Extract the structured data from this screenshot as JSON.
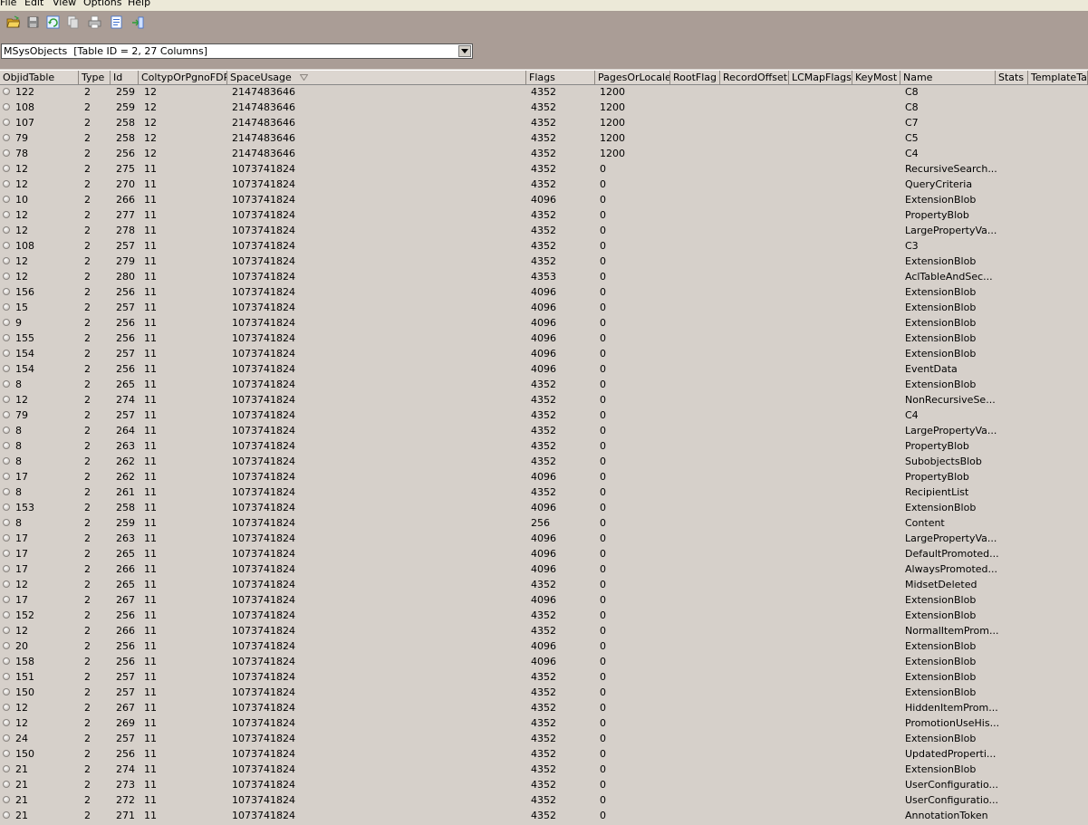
{
  "menu": [
    "File",
    "Edit",
    "View",
    "Options",
    "Help"
  ],
  "toolbar": [
    {
      "name": "open-icon",
      "color": "#d9a520"
    },
    {
      "name": "save-icon",
      "color": "#8c8c8c"
    },
    {
      "name": "refresh-icon",
      "color": "#2f9e3a"
    },
    {
      "name": "copy-icon",
      "color": "#8c8c8c"
    },
    {
      "name": "print-icon",
      "color": "#8c8c8c"
    },
    {
      "name": "export-icon",
      "color": "#3a6fd0"
    },
    {
      "name": "exit-icon",
      "color": "#3a6fd0"
    }
  ],
  "table_select": {
    "value": "MSysObjects  [Table ID = 2, 27 Columns]"
  },
  "columns": [
    "ObjidTable",
    "Type",
    "Id",
    "ColtypOrPgnoFDP",
    "SpaceUsage",
    "Flags",
    "PagesOrLocale",
    "RootFlag",
    "RecordOffset",
    "LCMapFlags",
    "KeyMost",
    "Name",
    "Stats",
    "TemplateTab"
  ],
  "rows": [
    [
      "122",
      "2",
      "259",
      "12",
      "2147483646",
      "4352",
      "1200",
      "C8"
    ],
    [
      "108",
      "2",
      "259",
      "12",
      "2147483646",
      "4352",
      "1200",
      "C8"
    ],
    [
      "107",
      "2",
      "258",
      "12",
      "2147483646",
      "4352",
      "1200",
      "C7"
    ],
    [
      "79",
      "2",
      "258",
      "12",
      "2147483646",
      "4352",
      "1200",
      "C5"
    ],
    [
      "78",
      "2",
      "256",
      "12",
      "2147483646",
      "4352",
      "1200",
      "C4"
    ],
    [
      "12",
      "2",
      "275",
      "11",
      "1073741824",
      "4352",
      "0",
      "RecursiveSearch..."
    ],
    [
      "12",
      "2",
      "270",
      "11",
      "1073741824",
      "4352",
      "0",
      "QueryCriteria"
    ],
    [
      "10",
      "2",
      "266",
      "11",
      "1073741824",
      "4096",
      "0",
      "ExtensionBlob"
    ],
    [
      "12",
      "2",
      "277",
      "11",
      "1073741824",
      "4352",
      "0",
      "PropertyBlob"
    ],
    [
      "12",
      "2",
      "278",
      "11",
      "1073741824",
      "4352",
      "0",
      "LargePropertyVa..."
    ],
    [
      "108",
      "2",
      "257",
      "11",
      "1073741824",
      "4352",
      "0",
      "C3"
    ],
    [
      "12",
      "2",
      "279",
      "11",
      "1073741824",
      "4352",
      "0",
      "ExtensionBlob"
    ],
    [
      "12",
      "2",
      "280",
      "11",
      "1073741824",
      "4353",
      "0",
      "AclTableAndSec..."
    ],
    [
      "156",
      "2",
      "256",
      "11",
      "1073741824",
      "4096",
      "0",
      "ExtensionBlob"
    ],
    [
      "15",
      "2",
      "257",
      "11",
      "1073741824",
      "4096",
      "0",
      "ExtensionBlob"
    ],
    [
      "9",
      "2",
      "256",
      "11",
      "1073741824",
      "4096",
      "0",
      "ExtensionBlob"
    ],
    [
      "155",
      "2",
      "256",
      "11",
      "1073741824",
      "4096",
      "0",
      "ExtensionBlob"
    ],
    [
      "154",
      "2",
      "257",
      "11",
      "1073741824",
      "4096",
      "0",
      "ExtensionBlob"
    ],
    [
      "154",
      "2",
      "256",
      "11",
      "1073741824",
      "4096",
      "0",
      "EventData"
    ],
    [
      "8",
      "2",
      "265",
      "11",
      "1073741824",
      "4352",
      "0",
      "ExtensionBlob"
    ],
    [
      "12",
      "2",
      "274",
      "11",
      "1073741824",
      "4352",
      "0",
      "NonRecursiveSe..."
    ],
    [
      "79",
      "2",
      "257",
      "11",
      "1073741824",
      "4352",
      "0",
      "C4"
    ],
    [
      "8",
      "2",
      "264",
      "11",
      "1073741824",
      "4352",
      "0",
      "LargePropertyVa..."
    ],
    [
      "8",
      "2",
      "263",
      "11",
      "1073741824",
      "4352",
      "0",
      "PropertyBlob"
    ],
    [
      "8",
      "2",
      "262",
      "11",
      "1073741824",
      "4352",
      "0",
      "SubobjectsBlob"
    ],
    [
      "17",
      "2",
      "262",
      "11",
      "1073741824",
      "4096",
      "0",
      "PropertyBlob"
    ],
    [
      "8",
      "2",
      "261",
      "11",
      "1073741824",
      "4352",
      "0",
      "RecipientList"
    ],
    [
      "153",
      "2",
      "258",
      "11",
      "1073741824",
      "4096",
      "0",
      "ExtensionBlob"
    ],
    [
      "8",
      "2",
      "259",
      "11",
      "1073741824",
      "256",
      "0",
      "Content"
    ],
    [
      "17",
      "2",
      "263",
      "11",
      "1073741824",
      "4096",
      "0",
      "LargePropertyVa..."
    ],
    [
      "17",
      "2",
      "265",
      "11",
      "1073741824",
      "4096",
      "0",
      "DefaultPromoted..."
    ],
    [
      "17",
      "2",
      "266",
      "11",
      "1073741824",
      "4096",
      "0",
      "AlwaysPromoted..."
    ],
    [
      "12",
      "2",
      "265",
      "11",
      "1073741824",
      "4352",
      "0",
      "MidsetDeleted"
    ],
    [
      "17",
      "2",
      "267",
      "11",
      "1073741824",
      "4096",
      "0",
      "ExtensionBlob"
    ],
    [
      "152",
      "2",
      "256",
      "11",
      "1073741824",
      "4352",
      "0",
      "ExtensionBlob"
    ],
    [
      "12",
      "2",
      "266",
      "11",
      "1073741824",
      "4352",
      "0",
      "NormalItemProm..."
    ],
    [
      "20",
      "2",
      "256",
      "11",
      "1073741824",
      "4096",
      "0",
      "ExtensionBlob"
    ],
    [
      "158",
      "2",
      "256",
      "11",
      "1073741824",
      "4096",
      "0",
      "ExtensionBlob"
    ],
    [
      "151",
      "2",
      "257",
      "11",
      "1073741824",
      "4352",
      "0",
      "ExtensionBlob"
    ],
    [
      "150",
      "2",
      "257",
      "11",
      "1073741824",
      "4352",
      "0",
      "ExtensionBlob"
    ],
    [
      "12",
      "2",
      "267",
      "11",
      "1073741824",
      "4352",
      "0",
      "HiddenItemProm..."
    ],
    [
      "12",
      "2",
      "269",
      "11",
      "1073741824",
      "4352",
      "0",
      "PromotionUseHis..."
    ],
    [
      "24",
      "2",
      "257",
      "11",
      "1073741824",
      "4352",
      "0",
      "ExtensionBlob"
    ],
    [
      "150",
      "2",
      "256",
      "11",
      "1073741824",
      "4352",
      "0",
      "UpdatedProperti..."
    ],
    [
      "21",
      "2",
      "274",
      "11",
      "1073741824",
      "4352",
      "0",
      "ExtensionBlob"
    ],
    [
      "21",
      "2",
      "273",
      "11",
      "1073741824",
      "4352",
      "0",
      "UserConfiguratio..."
    ],
    [
      "21",
      "2",
      "272",
      "11",
      "1073741824",
      "4352",
      "0",
      "UserConfiguratio..."
    ],
    [
      "21",
      "2",
      "271",
      "11",
      "1073741824",
      "4352",
      "0",
      "AnnotationToken"
    ]
  ]
}
